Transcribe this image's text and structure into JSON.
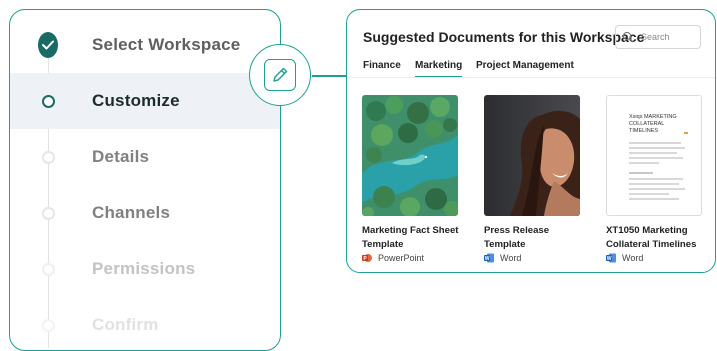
{
  "steps": [
    {
      "label": "Select Workspace",
      "state": "completed",
      "color": "#5f5f5f"
    },
    {
      "label": "Customize",
      "state": "active",
      "color": "#1d2b2b"
    },
    {
      "label": "Details",
      "state": "pending",
      "color": "#808080"
    },
    {
      "label": "Channels",
      "state": "pending",
      "color": "#808080"
    },
    {
      "label": "Permissions",
      "state": "pending",
      "color": "#c3c3c3"
    },
    {
      "label": "Confirm",
      "state": "pending",
      "color": "#e2e2e2"
    }
  ],
  "docs_panel": {
    "title": "Suggested Documents for this Workspace",
    "search_placeholder": "Search",
    "tabs": [
      "Finance",
      "Marketing",
      "Project Management"
    ],
    "active_tab": "Marketing"
  },
  "documents": [
    {
      "title_line1": "Marketing Fact Sheet",
      "title_line2": "Template",
      "app": "PowerPoint",
      "app_icon": "powerpoint-icon",
      "app_color": "#d04423"
    },
    {
      "title_line1": "Press Release Template",
      "title_line2": "",
      "app": "Word",
      "app_icon": "word-icon",
      "app_color": "#1f5cb8"
    },
    {
      "title_line1": "XT1050 Marketing",
      "title_line2": "Collateral Timelines",
      "app": "Word",
      "app_icon": "word-icon",
      "app_color": "#1f5cb8"
    }
  ],
  "doc_preview": {
    "brand": "Xsiqs MARKETING",
    "line1": "COLLATERAL",
    "line2": "TIMELINES"
  },
  "colors": {
    "accent": "#1f9e93",
    "step_marker": "#1a6b66",
    "active_bg": "#eef2f7"
  }
}
